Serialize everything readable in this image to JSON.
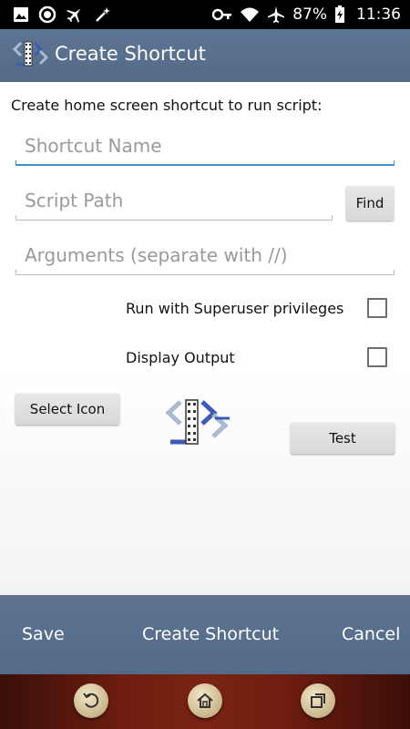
{
  "status_bar": {
    "battery_percent": "87%",
    "time": "11:36",
    "left_icons": [
      "image-icon",
      "record-icon",
      "airplane-icon",
      "wand-icon"
    ],
    "right_icons": [
      "key-icon",
      "wifi-icon",
      "airplane-mode-icon",
      "battery-icon"
    ]
  },
  "action_bar": {
    "title": "Create Shortcut"
  },
  "form": {
    "prompt": "Create home screen shortcut to run script:",
    "shortcut_name": {
      "value": "",
      "placeholder": "Shortcut Name"
    },
    "script_path": {
      "value": "",
      "placeholder": "Script Path"
    },
    "find_label": "Find",
    "arguments": {
      "value": "",
      "placeholder": "Arguments (separate with //)"
    },
    "superuser_label": "Run with Superuser privileges",
    "superuser_checked": false,
    "display_output_label": "Display Output",
    "display_output_checked": false,
    "select_icon_label": "Select Icon",
    "test_label": "Test"
  },
  "bottom_bar": {
    "save_label": "Save",
    "create_label": "Create Shortcut",
    "cancel_label": "Cancel"
  },
  "colors": {
    "action_bar": "#546a87",
    "focus_underline": "#4a90c8",
    "logo_blue": "#3d5bb5",
    "logo_light": "#9fb3c8"
  }
}
